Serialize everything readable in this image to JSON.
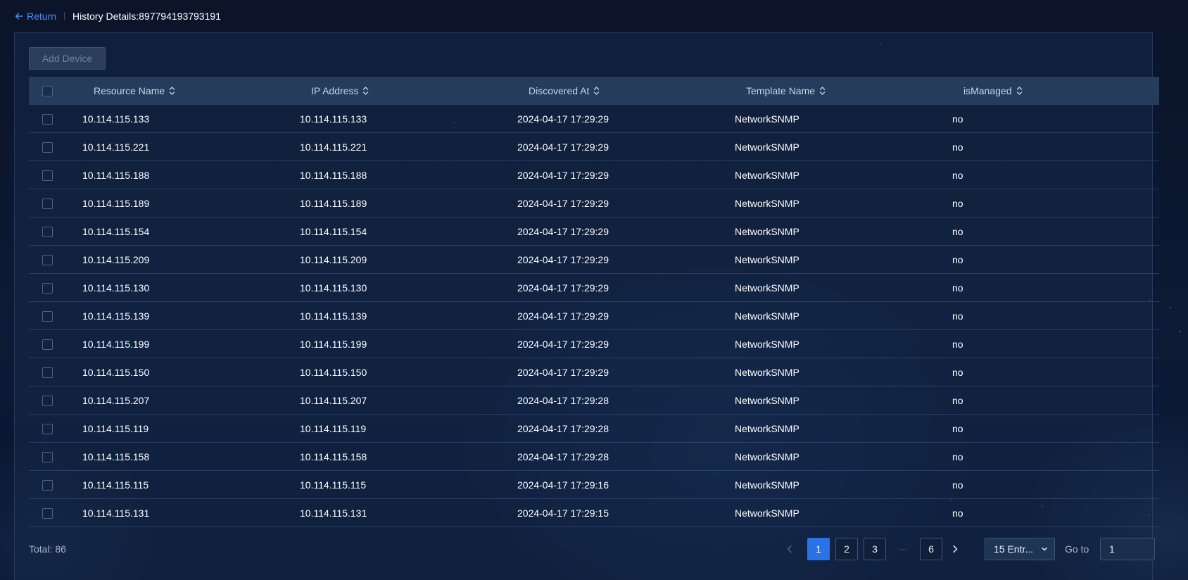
{
  "header": {
    "return_label": "Return",
    "title": "History Details:897794193793191"
  },
  "toolbar": {
    "add_device_label": "Add Device",
    "add_device_disabled": true
  },
  "table": {
    "columns": [
      "Resource Name",
      "IP Address",
      "Discovered At",
      "Template Name",
      "isManaged"
    ],
    "rows": [
      [
        "10.114.115.133",
        "10.114.115.133",
        "2024-04-17 17:29:29",
        "NetworkSNMP",
        "no"
      ],
      [
        "10.114.115.221",
        "10.114.115.221",
        "2024-04-17 17:29:29",
        "NetworkSNMP",
        "no"
      ],
      [
        "10.114.115.188",
        "10.114.115.188",
        "2024-04-17 17:29:29",
        "NetworkSNMP",
        "no"
      ],
      [
        "10.114.115.189",
        "10.114.115.189",
        "2024-04-17 17:29:29",
        "NetworkSNMP",
        "no"
      ],
      [
        "10.114.115.154",
        "10.114.115.154",
        "2024-04-17 17:29:29",
        "NetworkSNMP",
        "no"
      ],
      [
        "10.114.115.209",
        "10.114.115.209",
        "2024-04-17 17:29:29",
        "NetworkSNMP",
        "no"
      ],
      [
        "10.114.115.130",
        "10.114.115.130",
        "2024-04-17 17:29:29",
        "NetworkSNMP",
        "no"
      ],
      [
        "10.114.115.139",
        "10.114.115.139",
        "2024-04-17 17:29:29",
        "NetworkSNMP",
        "no"
      ],
      [
        "10.114.115.199",
        "10.114.115.199",
        "2024-04-17 17:29:29",
        "NetworkSNMP",
        "no"
      ],
      [
        "10.114.115.150",
        "10.114.115.150",
        "2024-04-17 17:29:29",
        "NetworkSNMP",
        "no"
      ],
      [
        "10.114.115.207",
        "10.114.115.207",
        "2024-04-17 17:29:28",
        "NetworkSNMP",
        "no"
      ],
      [
        "10.114.115.119",
        "10.114.115.119",
        "2024-04-17 17:29:28",
        "NetworkSNMP",
        "no"
      ],
      [
        "10.114.115.158",
        "10.114.115.158",
        "2024-04-17 17:29:28",
        "NetworkSNMP",
        "no"
      ],
      [
        "10.114.115.115",
        "10.114.115.115",
        "2024-04-17 17:29:16",
        "NetworkSNMP",
        "no"
      ],
      [
        "10.114.115.131",
        "10.114.115.131",
        "2024-04-17 17:29:15",
        "NetworkSNMP",
        "no"
      ]
    ]
  },
  "footer": {
    "total_label": "Total: 86",
    "pages": [
      "1",
      "2",
      "3",
      "6"
    ],
    "current_page": "1",
    "ellipsis": "···",
    "page_size": "15 Entr...",
    "goto_label": "Go to",
    "goto_value": "1"
  },
  "colors": {
    "accent": "#2b72e6",
    "link": "#4d8ff0",
    "header_bg": "#253c5c",
    "page_bg": "#0b1428"
  },
  "icons": [
    "arrow-left-icon",
    "sort-icon",
    "chevron-left-icon",
    "chevron-right-icon",
    "chevron-down-icon"
  ]
}
